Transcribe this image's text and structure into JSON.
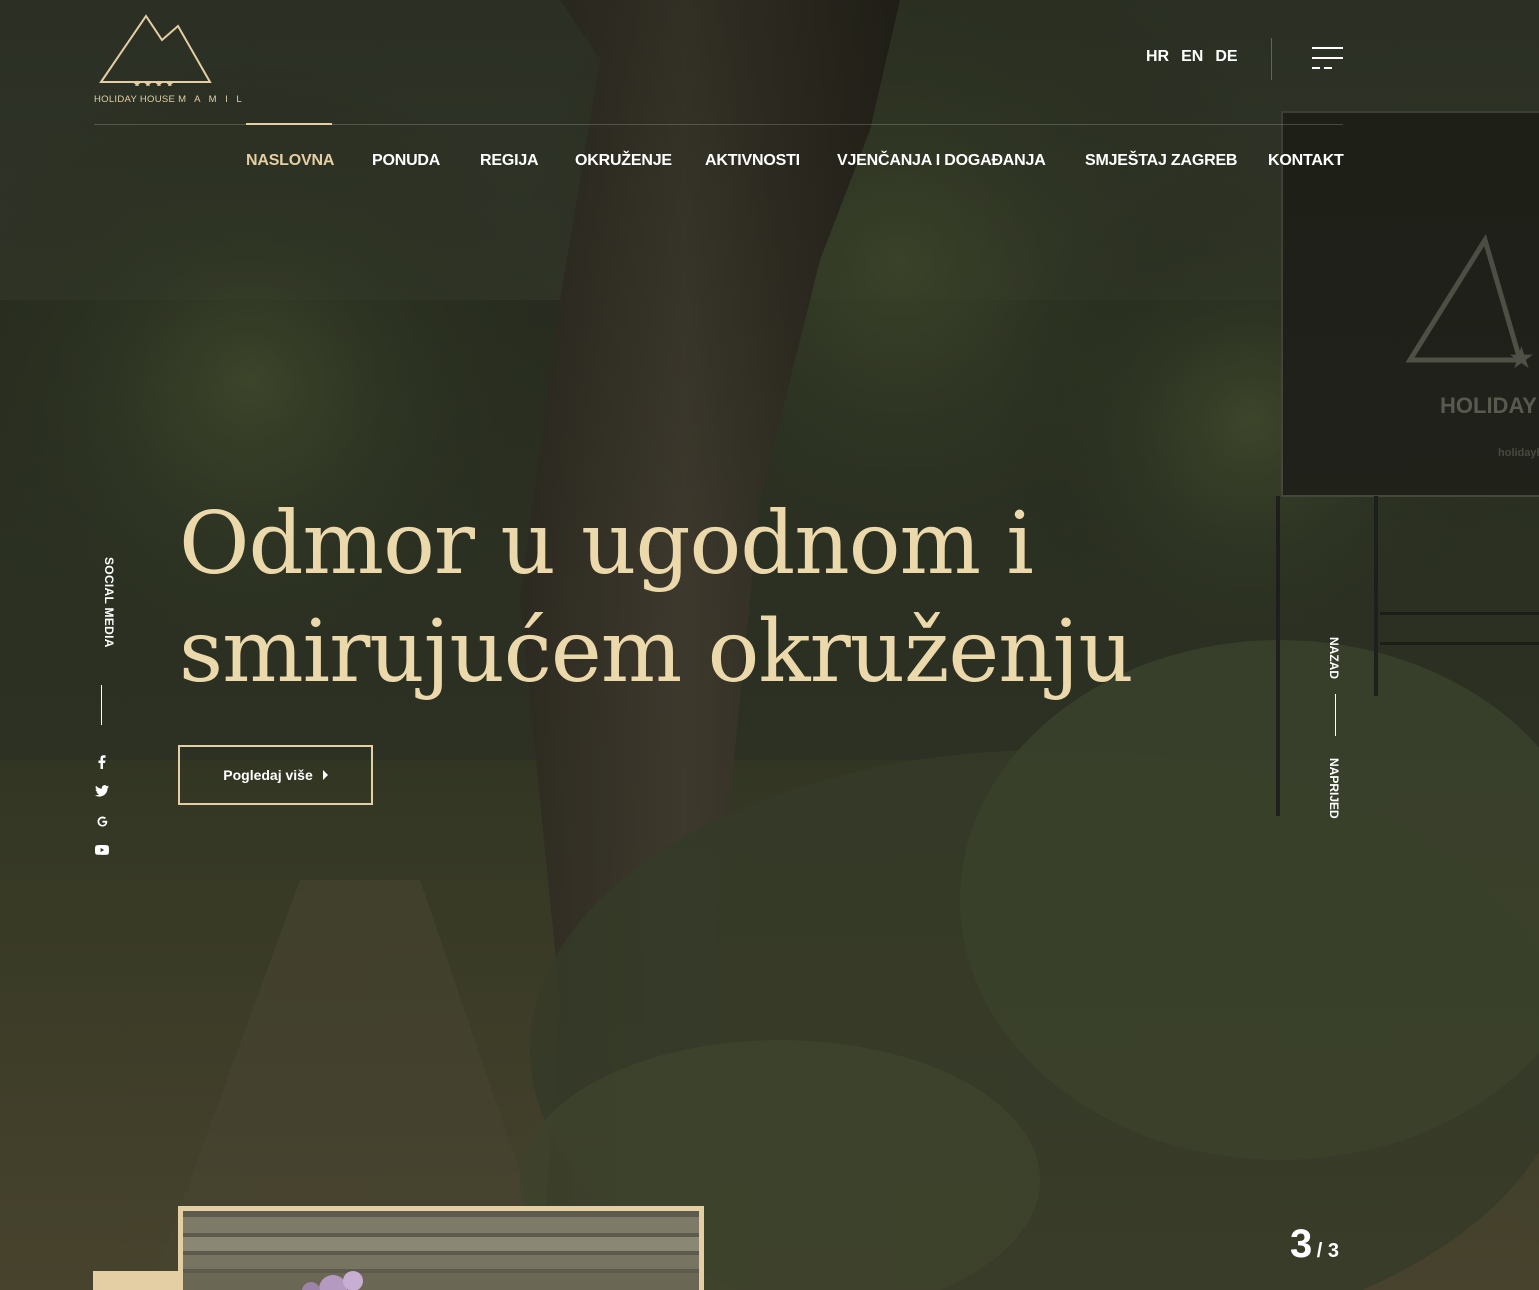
{
  "brand": {
    "name": "HOLIDAY HOUSE",
    "name_spaced": "M A M I L",
    "stars": "★ ★ ★ ★"
  },
  "languages": [
    "HR",
    "EN",
    "DE"
  ],
  "nav": {
    "items": [
      {
        "label": "NASLOVNA",
        "active": true
      },
      {
        "label": "PONUDA"
      },
      {
        "label": "REGIJA"
      },
      {
        "label": "OKRUŽENJE"
      },
      {
        "label": "AKTIVNOSTI"
      },
      {
        "label": "VJENČANJA I DOGAĐANJA"
      },
      {
        "label": "SMJEŠTAJ ZAGREB"
      },
      {
        "label": "KONTAKT"
      }
    ]
  },
  "hero": {
    "headline_line1": "Odmor u ugodnom i",
    "headline_line2": "smirujućem okruženju",
    "cta_label": "Pogledaj više"
  },
  "social": {
    "label": "SOCIAL MEDIA",
    "icons": [
      "facebook-icon",
      "twitter-icon",
      "google-icon",
      "youtube-icon"
    ]
  },
  "slider": {
    "prev_label": "NAZAD",
    "next_label": "NAPRIJED",
    "current": "3",
    "total": "/ 3"
  },
  "sign": {
    "text": "HOLIDAY",
    "url_fragment": "holidayh"
  },
  "colors": {
    "accent": "#e3cfa3",
    "headline": "#ebd9ac"
  }
}
